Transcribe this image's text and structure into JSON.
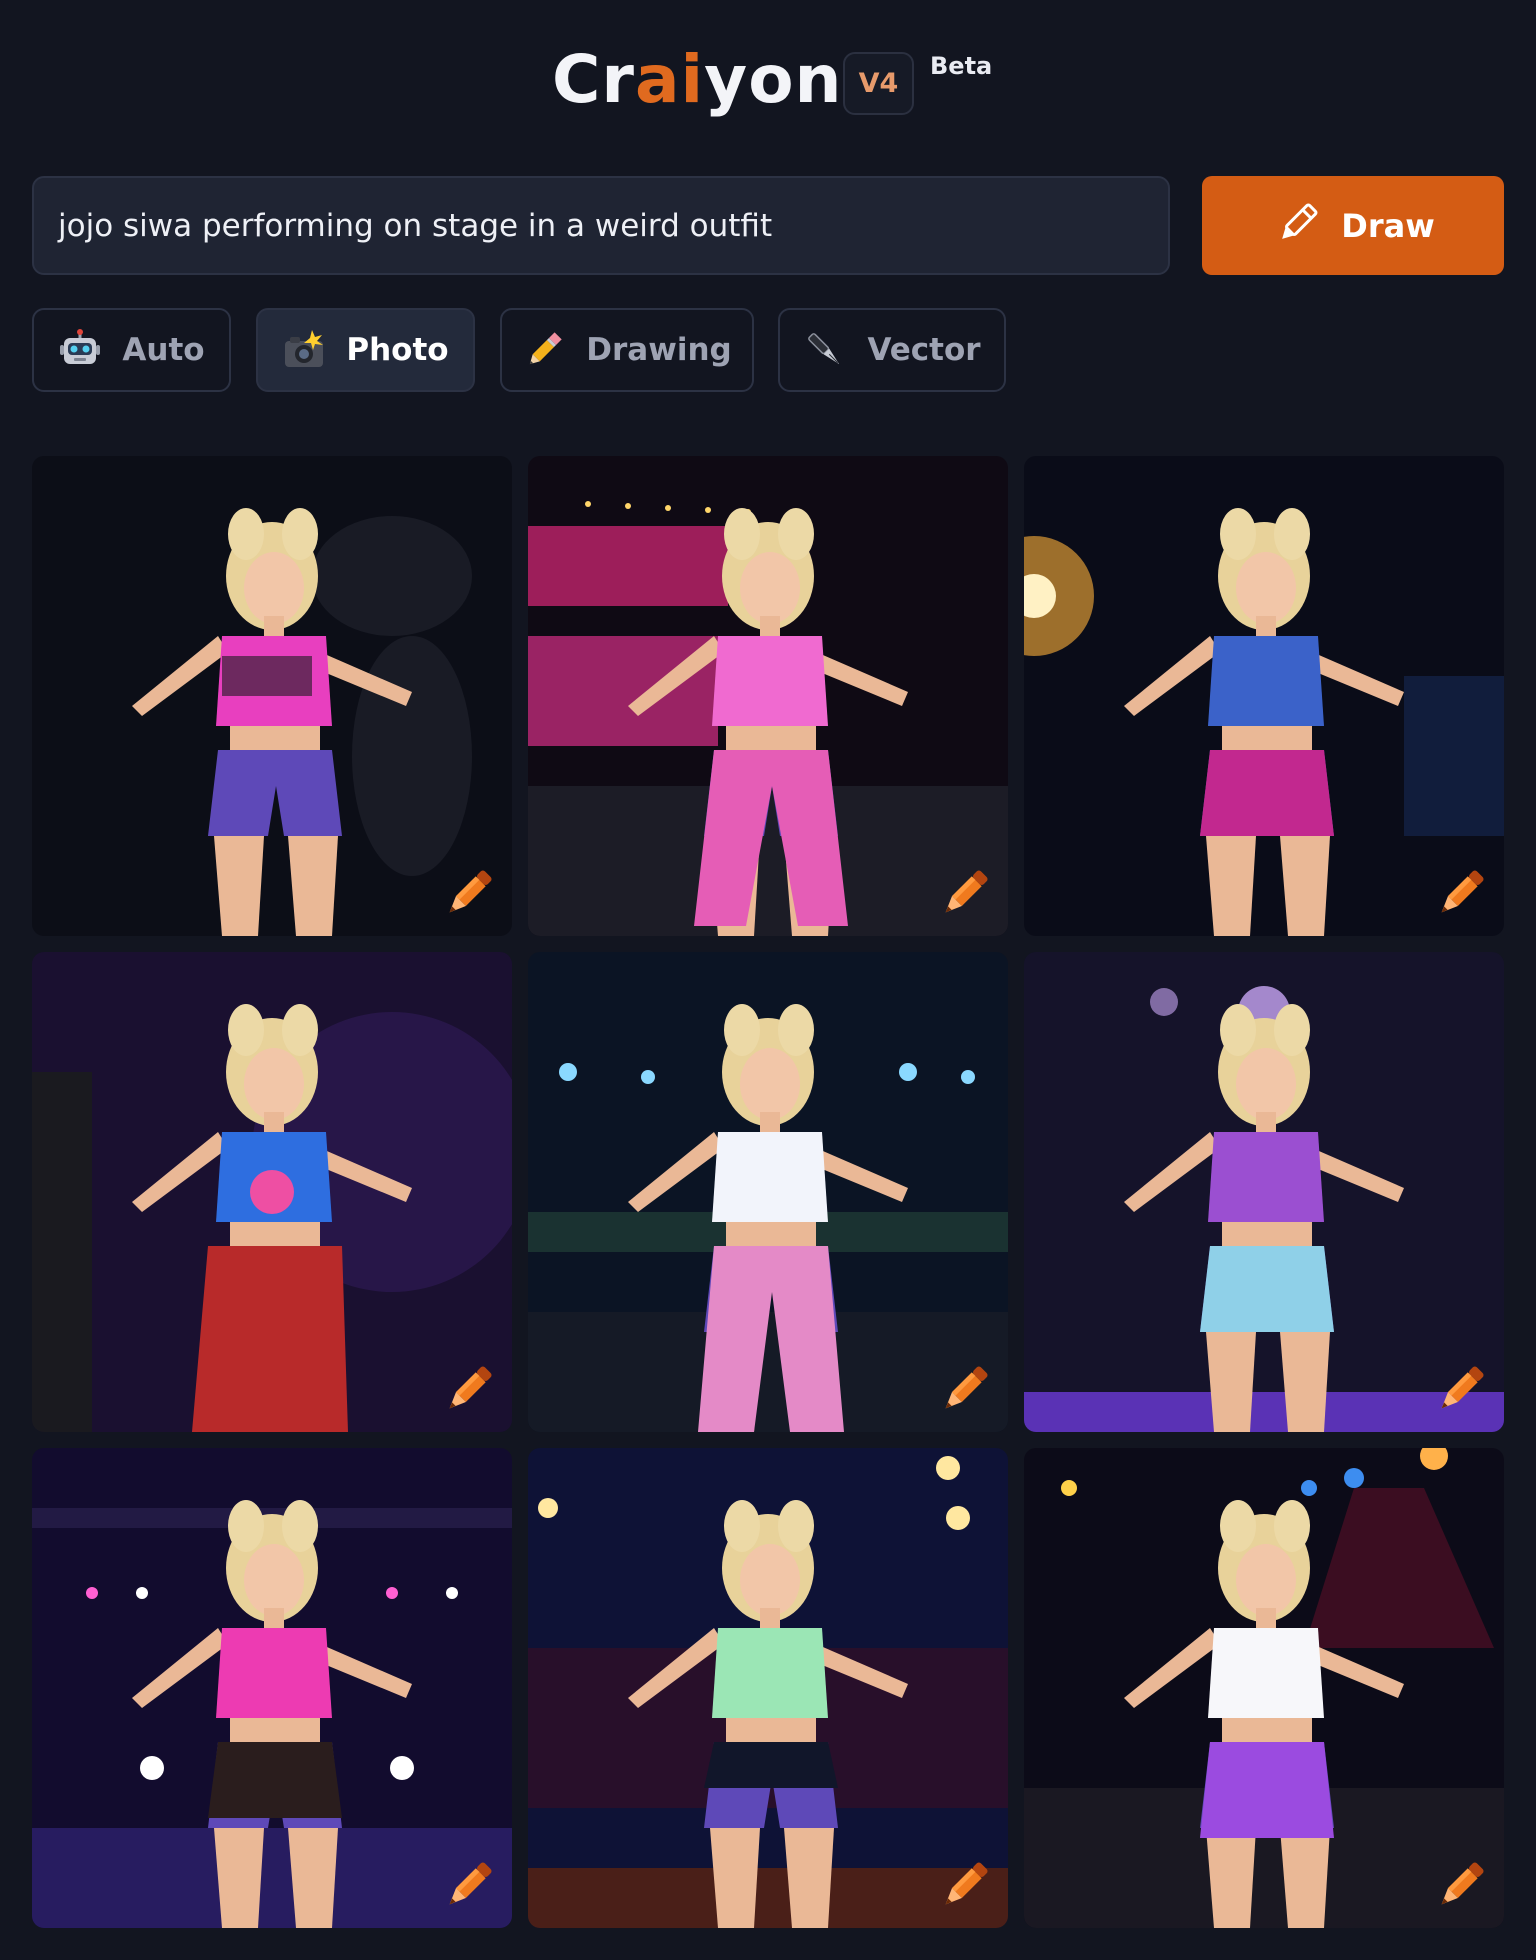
{
  "header": {
    "logo_part1": "Cr",
    "logo_accent": "ai",
    "logo_part2": "yon",
    "version": "V4",
    "beta_label": "Beta"
  },
  "prompt": {
    "value": "jojo siwa performing on stage in a weird outfit",
    "draw_label": "Draw",
    "draw_icon": "pencil-icon"
  },
  "modes": [
    {
      "label": "Auto",
      "icon": "robot-icon",
      "active": false
    },
    {
      "label": "Photo",
      "icon": "camera-flash-icon",
      "active": true
    },
    {
      "label": "Drawing",
      "icon": "pencil-icon",
      "active": false
    },
    {
      "label": "Vector",
      "icon": "pen-nib-icon",
      "active": false
    }
  ],
  "results": {
    "count": 9,
    "edit_icon": "orange-pencil-icon"
  },
  "colors": {
    "background": "#121520",
    "accent": "#d45c14",
    "input_bg": "#1f2433"
  }
}
